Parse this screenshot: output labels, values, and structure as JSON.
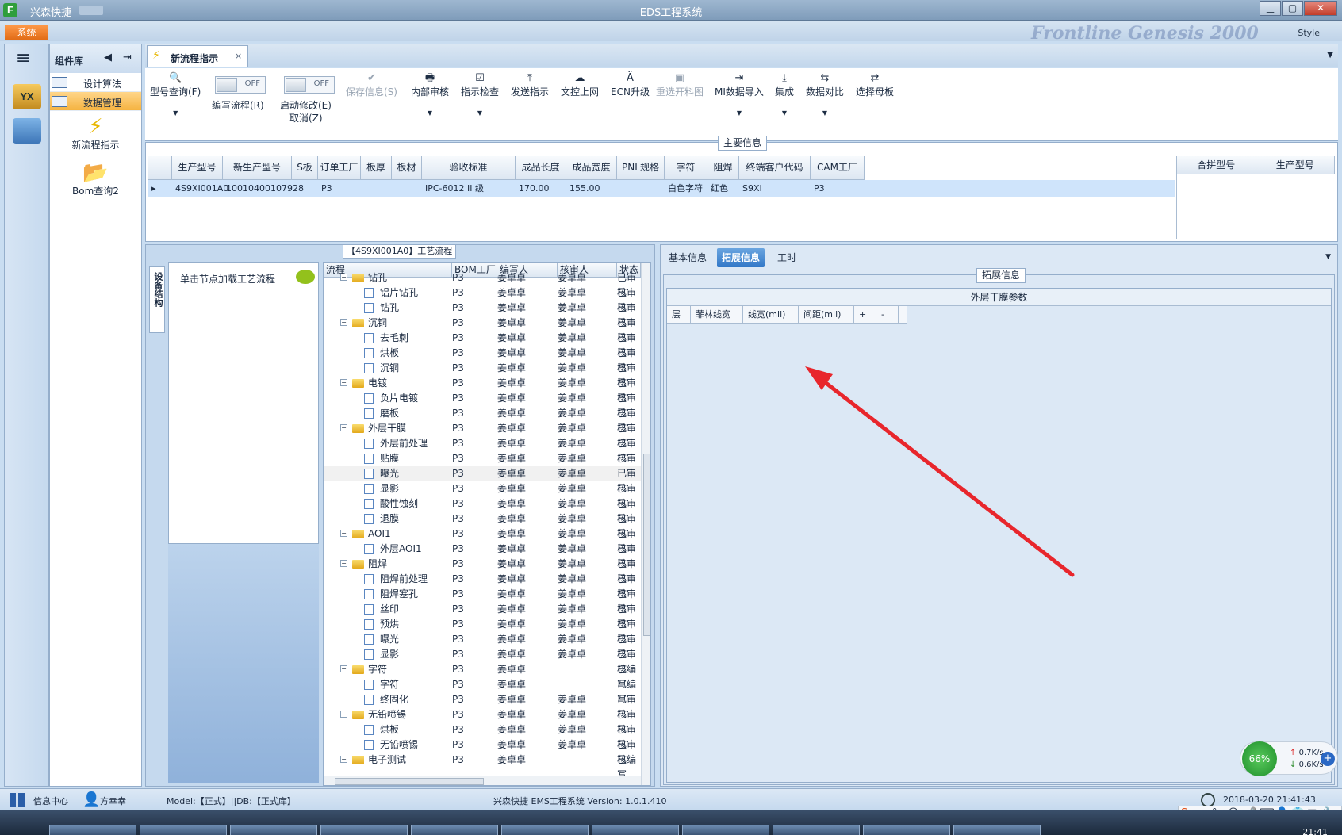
{
  "app": {
    "name": "兴森快捷",
    "window_title": "EDS工程系统",
    "system_menu": "系统",
    "style_label": "Style",
    "banner": "Frontline  Genesis 2000"
  },
  "complib": {
    "title": "组件库",
    "items": [
      {
        "label": "设计算法"
      },
      {
        "label": "数据管理"
      }
    ],
    "big_items": [
      {
        "label": "新流程指示"
      },
      {
        "label": "Bom查询2"
      }
    ]
  },
  "doctab": {
    "label": "新流程指示",
    "close": "×"
  },
  "toolbar": {
    "model_query": "型号查询(F)",
    "write_flow": "编写流程(R)",
    "start_modify": "启动修改(E)",
    "cancel": "取消(Z)",
    "toggle_off": "OFF",
    "save_info": "保存信息(S)",
    "internal_review": "内部审核",
    "instruction_check": "指示检查",
    "send_instruction": "发送指示",
    "doc_upload": "文控上网",
    "ecn_upgrade": "ECN升级",
    "reselect_image": "重选开料图",
    "mi_import": "MI数据导入",
    "integrate": "集成",
    "data_compare": "数据对比",
    "select_motherboard": "选择母板"
  },
  "maininfo": {
    "title": "主要信息",
    "columns": [
      "生产型号",
      "新生产型号",
      "S板",
      "订单工厂",
      "板厚",
      "板材",
      "验收标准",
      "成品长度",
      "成品宽度",
      "PNL规格",
      "字符",
      "阻焊",
      "终端客户代码",
      "CAM工厂"
    ],
    "row": [
      "4S9XI001A0",
      "10010400107928",
      "",
      "P3",
      "",
      "",
      "IPC-6012 II 级",
      "170.00",
      "155.00",
      "",
      "白色字符",
      "红色",
      "S9XI",
      "P3"
    ],
    "merge_columns": [
      "合拼型号",
      "生产型号"
    ]
  },
  "flow": {
    "title": "【4S9XI001A0】工艺流程",
    "struct_tab": "设备结构",
    "node_hint": "单击节点加载工艺流程",
    "columns": [
      "流程",
      "BOM工厂",
      "编写人",
      "核审人",
      "状态"
    ],
    "rows": [
      {
        "name": "钻孔",
        "level": 0,
        "factory": "P3",
        "writer": "姜卓卓",
        "reviewer": "姜卓卓",
        "status": "已审核"
      },
      {
        "name": "铝片钻孔",
        "level": 1,
        "factory": "P3",
        "writer": "姜卓卓",
        "reviewer": "姜卓卓",
        "status": "已审核"
      },
      {
        "name": "钻孔",
        "level": 1,
        "factory": "P3",
        "writer": "姜卓卓",
        "reviewer": "姜卓卓",
        "status": "已审核"
      },
      {
        "name": "沉铜",
        "level": 0,
        "factory": "P3",
        "writer": "姜卓卓",
        "reviewer": "姜卓卓",
        "status": "已审核"
      },
      {
        "name": "去毛刺",
        "level": 1,
        "factory": "P3",
        "writer": "姜卓卓",
        "reviewer": "姜卓卓",
        "status": "已审核"
      },
      {
        "name": "烘板",
        "level": 1,
        "factory": "P3",
        "writer": "姜卓卓",
        "reviewer": "姜卓卓",
        "status": "已审核"
      },
      {
        "name": "沉铜",
        "level": 1,
        "factory": "P3",
        "writer": "姜卓卓",
        "reviewer": "姜卓卓",
        "status": "已审核"
      },
      {
        "name": "电镀",
        "level": 0,
        "factory": "P3",
        "writer": "姜卓卓",
        "reviewer": "姜卓卓",
        "status": "已审核"
      },
      {
        "name": "负片电镀",
        "level": 1,
        "factory": "P3",
        "writer": "姜卓卓",
        "reviewer": "姜卓卓",
        "status": "已审核"
      },
      {
        "name": "磨板",
        "level": 1,
        "factory": "P3",
        "writer": "姜卓卓",
        "reviewer": "姜卓卓",
        "status": "已审核"
      },
      {
        "name": "外层干膜",
        "level": 0,
        "factory": "P3",
        "writer": "姜卓卓",
        "reviewer": "姜卓卓",
        "status": "已审核"
      },
      {
        "name": "外层前处理",
        "level": 1,
        "factory": "P3",
        "writer": "姜卓卓",
        "reviewer": "姜卓卓",
        "status": "已审核"
      },
      {
        "name": "贴膜",
        "level": 1,
        "factory": "P3",
        "writer": "姜卓卓",
        "reviewer": "姜卓卓",
        "status": "已审核"
      },
      {
        "name": "曝光",
        "level": 1,
        "factory": "P3",
        "writer": "姜卓卓",
        "reviewer": "姜卓卓",
        "status": "已审核",
        "selected": true
      },
      {
        "name": "显影",
        "level": 1,
        "factory": "P3",
        "writer": "姜卓卓",
        "reviewer": "姜卓卓",
        "status": "已审核"
      },
      {
        "name": "酸性蚀刻",
        "level": 1,
        "factory": "P3",
        "writer": "姜卓卓",
        "reviewer": "姜卓卓",
        "status": "已审核"
      },
      {
        "name": "退膜",
        "level": 1,
        "factory": "P3",
        "writer": "姜卓卓",
        "reviewer": "姜卓卓",
        "status": "已审核"
      },
      {
        "name": "AOI1",
        "level": 0,
        "factory": "P3",
        "writer": "姜卓卓",
        "reviewer": "姜卓卓",
        "status": "已审核"
      },
      {
        "name": "外层AOI1",
        "level": 1,
        "factory": "P3",
        "writer": "姜卓卓",
        "reviewer": "姜卓卓",
        "status": "已审核"
      },
      {
        "name": "阻焊",
        "level": 0,
        "factory": "P3",
        "writer": "姜卓卓",
        "reviewer": "姜卓卓",
        "status": "已审核"
      },
      {
        "name": "阻焊前处理",
        "level": 1,
        "factory": "P3",
        "writer": "姜卓卓",
        "reviewer": "姜卓卓",
        "status": "已审核"
      },
      {
        "name": "阻焊塞孔",
        "level": 1,
        "factory": "P3",
        "writer": "姜卓卓",
        "reviewer": "姜卓卓",
        "status": "已审核"
      },
      {
        "name": "丝印",
        "level": 1,
        "factory": "P3",
        "writer": "姜卓卓",
        "reviewer": "姜卓卓",
        "status": "已审核"
      },
      {
        "name": "预烘",
        "level": 1,
        "factory": "P3",
        "writer": "姜卓卓",
        "reviewer": "姜卓卓",
        "status": "已审核"
      },
      {
        "name": "曝光",
        "level": 1,
        "factory": "P3",
        "writer": "姜卓卓",
        "reviewer": "姜卓卓",
        "status": "已审核"
      },
      {
        "name": "显影",
        "level": 1,
        "factory": "P3",
        "writer": "姜卓卓",
        "reviewer": "姜卓卓",
        "status": "已审核"
      },
      {
        "name": "字符",
        "level": 0,
        "factory": "P3",
        "writer": "姜卓卓",
        "reviewer": "",
        "status": "已编写"
      },
      {
        "name": "字符",
        "level": 1,
        "factory": "P3",
        "writer": "姜卓卓",
        "reviewer": "",
        "status": "已编写"
      },
      {
        "name": "终固化",
        "level": 1,
        "factory": "P3",
        "writer": "姜卓卓",
        "reviewer": "姜卓卓",
        "status": "已审核"
      },
      {
        "name": "无铅喷锡",
        "level": 0,
        "factory": "P3",
        "writer": "姜卓卓",
        "reviewer": "姜卓卓",
        "status": "已审核"
      },
      {
        "name": "烘板",
        "level": 1,
        "factory": "P3",
        "writer": "姜卓卓",
        "reviewer": "姜卓卓",
        "status": "已审核"
      },
      {
        "name": "无铅喷锡",
        "level": 1,
        "factory": "P3",
        "writer": "姜卓卓",
        "reviewer": "姜卓卓",
        "status": "已审核"
      },
      {
        "name": "电子测试",
        "level": 0,
        "factory": "P3",
        "writer": "姜卓卓",
        "reviewer": "",
        "status": "已编写"
      }
    ]
  },
  "right": {
    "tabs": [
      "基本信息",
      "拓展信息",
      "工时"
    ],
    "ext_title": "拓展信息",
    "param_title": "外层干膜参数",
    "param_columns": [
      "层",
      "菲林线宽",
      "线宽(mil)",
      "间距(mil)",
      "+",
      "-"
    ]
  },
  "status": {
    "info_center": "信息中心",
    "user": "方幸幸",
    "model_db": "Model:【正式】||DB:【正式库】",
    "version": "兴森快捷 EMS工程系统 Version: 1.0.1.410",
    "datetime": "2018-03-20 21:41:43"
  },
  "net": {
    "percent": "66%",
    "up": "0.7K/s",
    "down": "0.6K/s"
  },
  "tray": {
    "time": "21:41"
  },
  "colors": {
    "accent": "#3278c8",
    "orange": "#f5b341",
    "arrow": "#e8262c"
  }
}
